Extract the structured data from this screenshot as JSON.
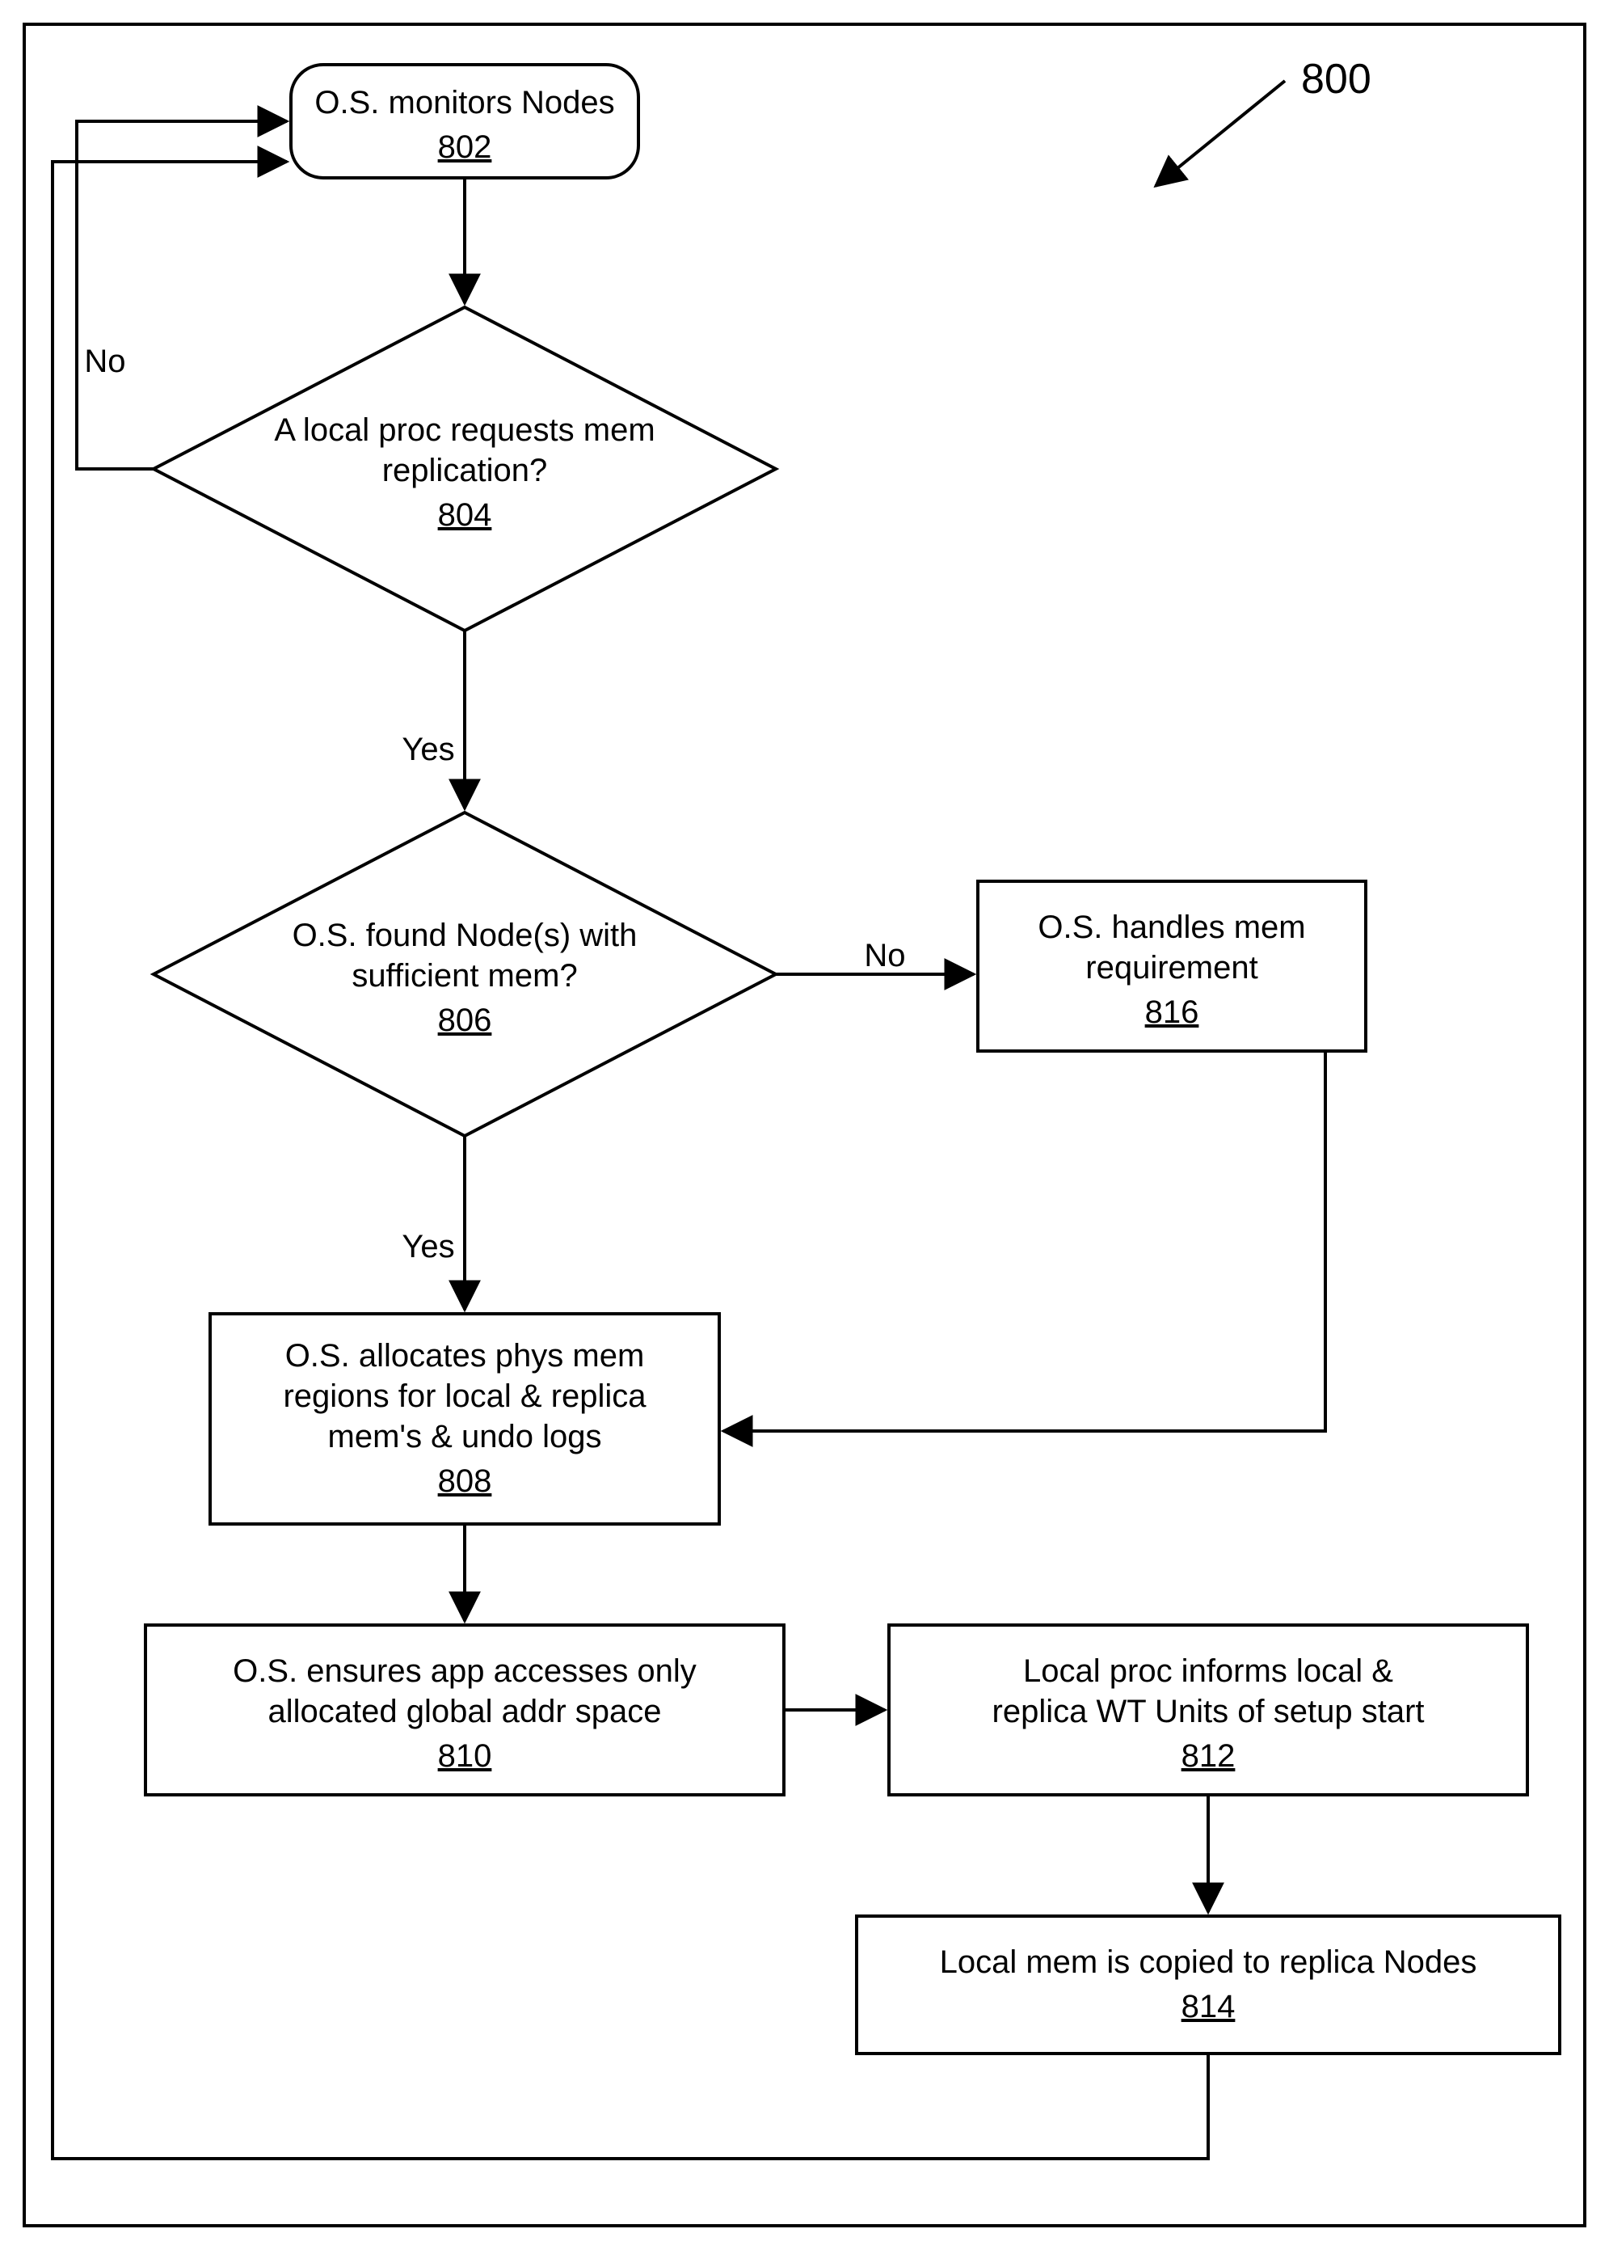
{
  "chart_data": {
    "type": "flowchart",
    "title": "",
    "diagram_label": "800",
    "nodes": [
      {
        "id": "802",
        "shape": "rounded-rect",
        "text": "O.S. monitors Nodes"
      },
      {
        "id": "804",
        "shape": "diamond",
        "text": "A local proc requests mem replication?"
      },
      {
        "id": "806",
        "shape": "diamond",
        "text": "O.S. found Node(s) with sufficient mem?"
      },
      {
        "id": "808",
        "shape": "rect",
        "text": "O.S. allocates phys mem regions for local & replica mem's & undo logs"
      },
      {
        "id": "810",
        "shape": "rect",
        "text": "O.S. ensures app accesses only allocated global addr space"
      },
      {
        "id": "812",
        "shape": "rect",
        "text": "Local proc informs local & replica WT Units of setup start"
      },
      {
        "id": "814",
        "shape": "rect",
        "text": "Local mem is copied to replica Nodes"
      },
      {
        "id": "816",
        "shape": "rect",
        "text": "O.S. handles mem requirement"
      }
    ],
    "edges": [
      {
        "from": "802",
        "to": "804",
        "label": ""
      },
      {
        "from": "804",
        "to": "802",
        "label": "No"
      },
      {
        "from": "804",
        "to": "806",
        "label": "Yes"
      },
      {
        "from": "806",
        "to": "816",
        "label": "No"
      },
      {
        "from": "806",
        "to": "808",
        "label": "Yes"
      },
      {
        "from": "816",
        "to": "808",
        "label": ""
      },
      {
        "from": "808",
        "to": "810",
        "label": ""
      },
      {
        "from": "810",
        "to": "812",
        "label": ""
      },
      {
        "from": "812",
        "to": "814",
        "label": ""
      },
      {
        "from": "814",
        "to": "802",
        "label": ""
      }
    ]
  },
  "nodes": {
    "n802": {
      "line1": "O.S. monitors Nodes",
      "ref": "802"
    },
    "n804": {
      "line1": "A local proc requests mem",
      "line2": "replication?",
      "ref": "804"
    },
    "n806": {
      "line1": "O.S. found Node(s) with",
      "line2": "sufficient mem?",
      "ref": "806"
    },
    "n808": {
      "line1": "O.S. allocates phys mem",
      "line2": "regions for local & replica",
      "line3": "mem's & undo logs",
      "ref": "808"
    },
    "n810": {
      "line1": "O.S. ensures app accesses only",
      "line2": "allocated global addr space",
      "ref": "810"
    },
    "n812": {
      "line1": "Local proc informs local &",
      "line2": "replica WT Units of setup start",
      "ref": "812"
    },
    "n814": {
      "line1": "Local mem is copied to replica Nodes",
      "ref": "814"
    },
    "n816": {
      "line1": "O.S. handles mem",
      "line2": "requirement",
      "ref": "816"
    }
  },
  "labels": {
    "yes": "Yes",
    "no": "No",
    "diagram_num": "800"
  }
}
